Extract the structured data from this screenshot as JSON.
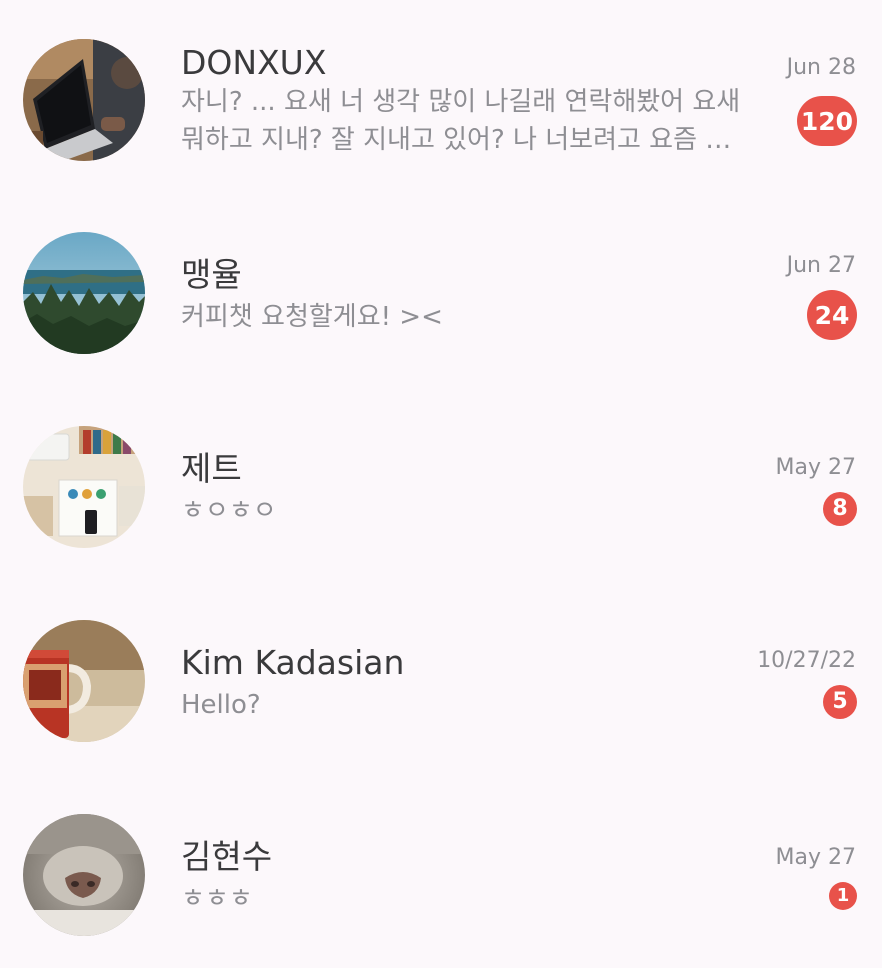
{
  "chats": [
    {
      "name": "DONXUX",
      "preview": "자니? ... 요새 너 생각 많이 나길래 연락해봤어 요새 뭐하고 지내? 잘 지내고 있어? 나 너보려고 요즘 연락하는데",
      "date": "Jun 28",
      "unread": "120",
      "avatar": "laptop-photo"
    },
    {
      "name": "맹율",
      "preview": "커피챗 요청할게요! ><",
      "date": "Jun 27",
      "unread": "24",
      "avatar": "forest-lake-photo"
    },
    {
      "name": "제트",
      "preview": "ㅎㅇㅎㅇ",
      "date": "May 27",
      "unread": "8",
      "avatar": "desk-flatlay-photo"
    },
    {
      "name": "Kim Kadasian",
      "preview": "Hello?",
      "date": "10/27/22",
      "unread": "5",
      "avatar": "coffee-mug-photo"
    },
    {
      "name": "김현수",
      "preview": "ㅎㅎㅎ",
      "date": "May 27",
      "unread": "1",
      "avatar": "cat-nose-photo"
    }
  ],
  "colors": {
    "background": "#fcf8fb",
    "badge": "#e8524a",
    "name_text": "#3a3a3c",
    "secondary_text": "#8e8e93"
  }
}
